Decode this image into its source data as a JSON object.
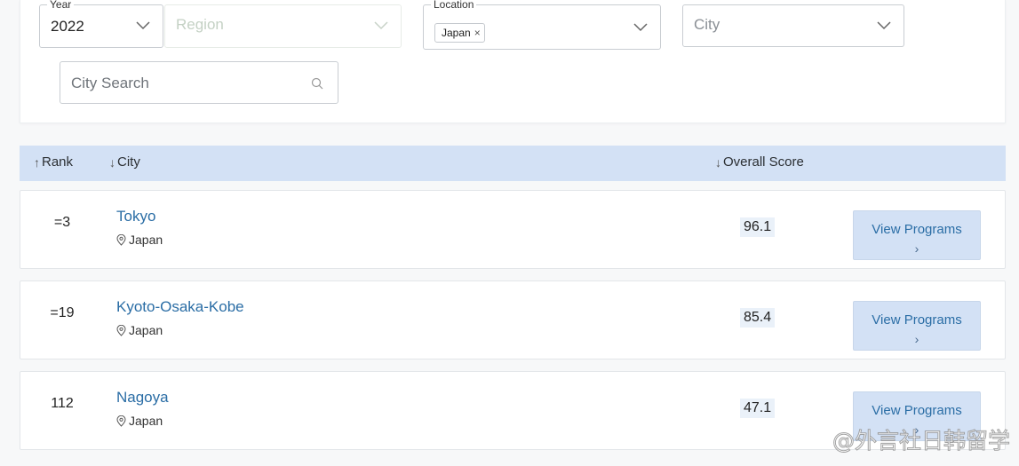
{
  "filters": {
    "year": {
      "legend": "Year",
      "value": "2022"
    },
    "region": {
      "placeholder": "Region"
    },
    "location": {
      "legend": "Location",
      "chip": "Japan",
      "chip_remove": "×"
    },
    "city": {
      "placeholder": "City"
    },
    "search": {
      "placeholder": "City Search",
      "value": ""
    }
  },
  "table": {
    "headers": {
      "rank": {
        "arrow": "↑",
        "label": "Rank"
      },
      "city": {
        "arrow": "↓",
        "label": "City"
      },
      "score": {
        "arrow": "↓",
        "label": "Overall Score"
      }
    },
    "rows": [
      {
        "rank": "=3",
        "city": "Tokyo",
        "location": "Japan",
        "score": "96.1",
        "button": "View Programs",
        "button_chevron": "›"
      },
      {
        "rank": "=19",
        "city": "Kyoto-Osaka-Kobe",
        "location": "Japan",
        "score": "85.4",
        "button": "View Programs",
        "button_chevron": "›"
      },
      {
        "rank": "112",
        "city": "Nagoya",
        "location": "Japan",
        "score": "47.1",
        "button": "View Programs",
        "button_chevron": "›"
      }
    ]
  },
  "watermark": "@外言社日韩留学"
}
